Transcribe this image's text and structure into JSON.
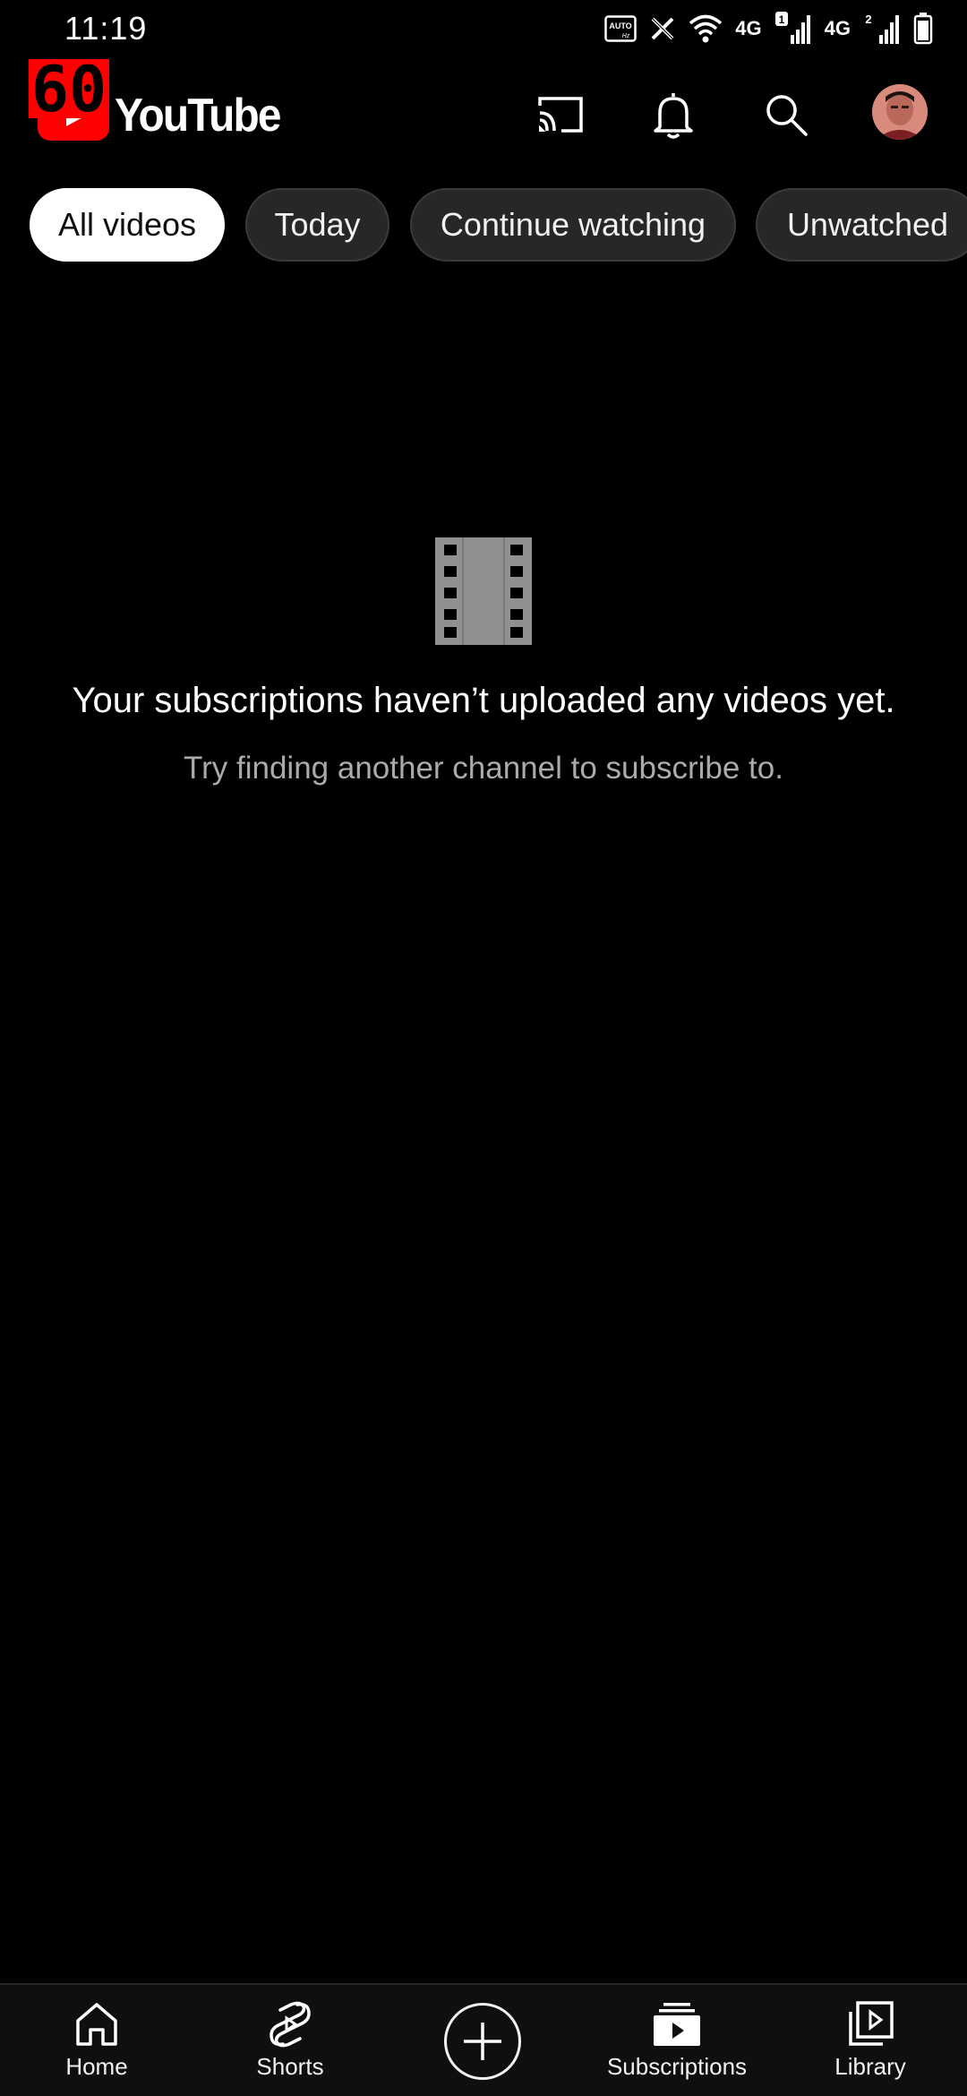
{
  "status_bar": {
    "time": "11:19",
    "net1": "4G",
    "net2": "4G",
    "sim1": "1",
    "sim2": "2",
    "auto_label": "AUTO"
  },
  "header": {
    "logo_text": "YouTube",
    "overlay_badge": "60",
    "cast_label": "Cast",
    "notifications_label": "Notifications",
    "search_label": "Search",
    "account_label": "Account"
  },
  "chips": [
    {
      "label": "All videos",
      "active": true
    },
    {
      "label": "Today",
      "active": false
    },
    {
      "label": "Continue watching",
      "active": false
    },
    {
      "label": "Unwatched",
      "active": false
    }
  ],
  "empty_state": {
    "icon": "film-icon",
    "title": "Your subscriptions haven’t uploaded any videos yet.",
    "subtitle": "Try finding another channel to subscribe to."
  },
  "bottom_nav": {
    "items": [
      {
        "label": "Home",
        "icon": "home-icon"
      },
      {
        "label": "Shorts",
        "icon": "shorts-icon"
      },
      {
        "label": "",
        "icon": "create-icon"
      },
      {
        "label": "Subscriptions",
        "icon": "subscriptions-icon",
        "active": true
      },
      {
        "label": "Library",
        "icon": "library-icon"
      }
    ]
  },
  "colors": {
    "background": "#000000",
    "brand_red": "#ff0000",
    "chip_bg": "#272727",
    "active_chip_bg": "#ffffff",
    "secondary_text": "#aaaaaa"
  }
}
